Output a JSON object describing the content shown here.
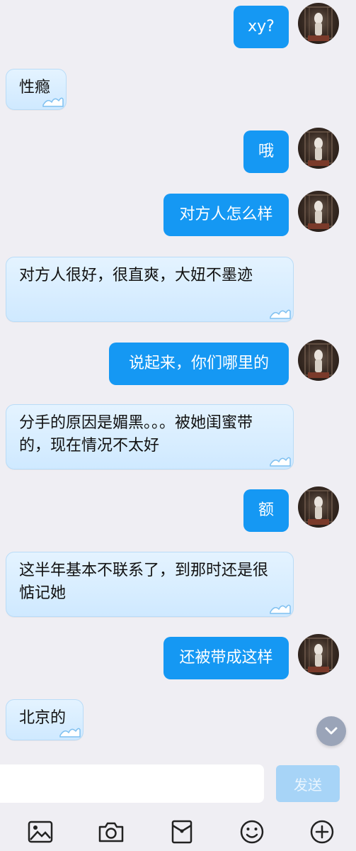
{
  "messages": [
    {
      "side": "out",
      "text": "xy?"
    },
    {
      "side": "in",
      "text": "性瘾"
    },
    {
      "side": "out",
      "text": "哦"
    },
    {
      "side": "out",
      "text": "对方人怎么样"
    },
    {
      "side": "in",
      "text": "对方人很好，很直爽，大妞不墨迹"
    },
    {
      "side": "out",
      "text": "说起来，你们哪里的"
    },
    {
      "side": "in",
      "text": "分手的原因是媚黑。。。被她闺蜜带的，现在情况不太好"
    },
    {
      "side": "out",
      "text": "额"
    },
    {
      "side": "in",
      "text": "这半年基本不联系了，到那时还是很惦记她"
    },
    {
      "side": "out",
      "text": "还被带成这样"
    },
    {
      "side": "in",
      "text": "北京的"
    }
  ],
  "input": {
    "value": "",
    "placeholder": ""
  },
  "send_label": "发送",
  "toolbar": {
    "icons": [
      "image-icon",
      "camera-icon",
      "red-packet-icon",
      "emoji-icon",
      "plus-icon"
    ]
  },
  "colors": {
    "outgoing_bubble": "#1598f3",
    "incoming_bubble": "#d8eeff",
    "background": "#efeef3",
    "send_button": "#a7d4f7"
  }
}
